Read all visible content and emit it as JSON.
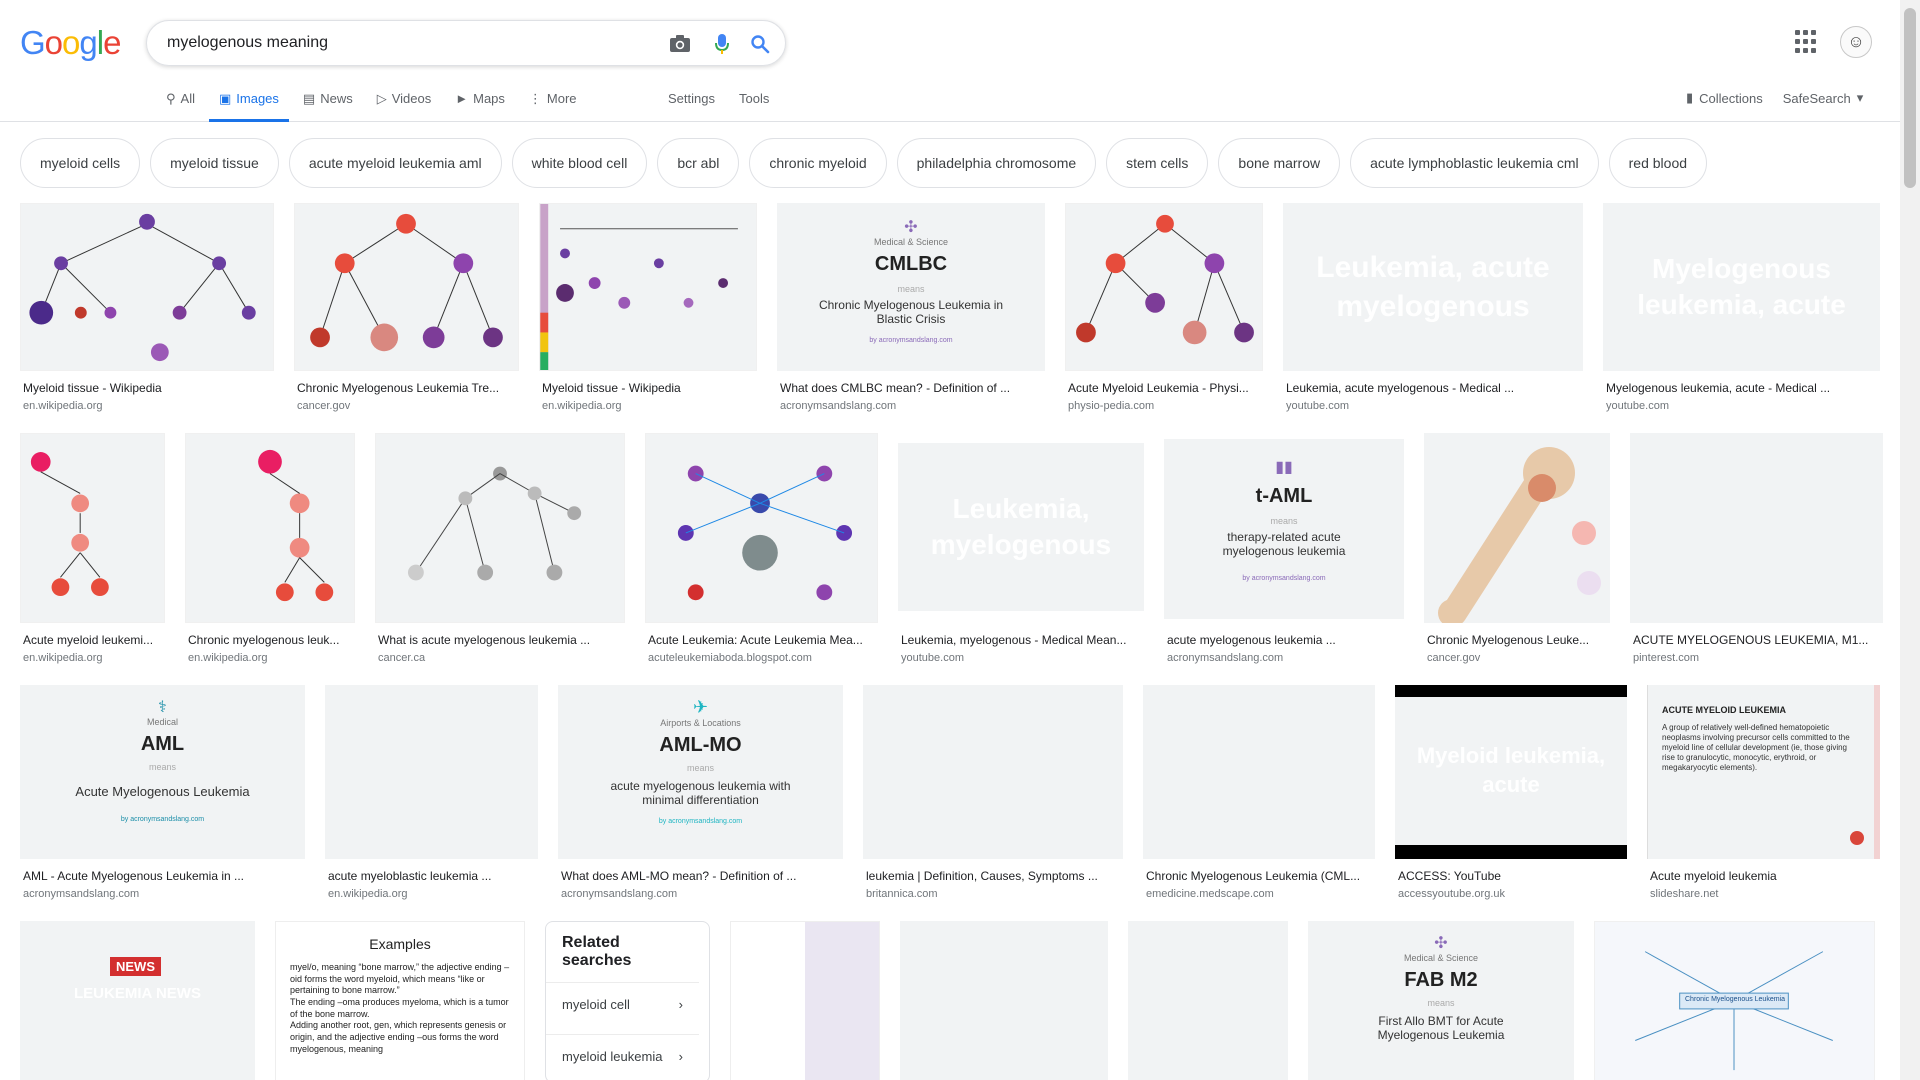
{
  "logo": {
    "g1": "G",
    "o1": "o",
    "o2": "o",
    "g2": "g",
    "l": "l",
    "e": "e"
  },
  "search": {
    "value": "myelogenous meaning"
  },
  "tabs": [
    {
      "label": "All",
      "icon": "search-icon"
    },
    {
      "label": "Images",
      "icon": "image-icon"
    },
    {
      "label": "News",
      "icon": "news-icon"
    },
    {
      "label": "Videos",
      "icon": "play-icon"
    },
    {
      "label": "Maps",
      "icon": "map-icon"
    },
    {
      "label": "More",
      "icon": "more-vert-icon"
    }
  ],
  "tools": {
    "settings": "Settings",
    "tools": "Tools"
  },
  "right_nav": {
    "collections": "Collections",
    "safesearch": "SafeSearch"
  },
  "chips": [
    "myeloid cells",
    "myeloid tissue",
    "acute myeloid leukemia aml",
    "white blood cell",
    "bcr abl",
    "chronic myeloid",
    "philadelphia chromosome",
    "stem cells",
    "bone marrow",
    "acute lymphoblastic leukemia cml",
    "red blood"
  ],
  "rows": [
    [
      {
        "title": "Myeloid tissue - Wikipedia",
        "src": "en.wikipedia.org"
      },
      {
        "title": "Chronic Myelogenous Leukemia Tre...",
        "src": "cancer.gov"
      },
      {
        "title": "Myeloid tissue - Wikipedia",
        "src": "en.wikipedia.org"
      },
      {
        "title": "What does CMLBC mean? - Definition of ...",
        "src": "acronymsandslang.com",
        "acr_top": "Medical & Science",
        "acr_big": "CMLBC",
        "acr_means": "means",
        "acr_full": "Chronic Myelogenous Leukemia in Blastic Crisis",
        "acr_brand": "by acronymsandslang.com"
      },
      {
        "title": "Acute Myeloid Leukemia - Physi...",
        "src": "physio-pedia.com"
      },
      {
        "title": "Leukemia, acute myelogenous - Medical ...",
        "src": "youtube.com",
        "overlay": "Leukemia, acute myelogenous"
      },
      {
        "title": "Myelogenous leukemia, acute - Medical ...",
        "src": "youtube.com",
        "overlay": "Myelogenous leukemia, acute"
      }
    ],
    [
      {
        "title": "Acute myeloid leukemi...",
        "src": "en.wikipedia.org"
      },
      {
        "title": "Chronic myelogenous leuk...",
        "src": "en.wikipedia.org"
      },
      {
        "title": "What is acute myelogenous leukemia ...",
        "src": "cancer.ca"
      },
      {
        "title": "Acute Leukemia: Acute Leukemia Mea...",
        "src": "acuteleukemiaboda.blogspot.com"
      },
      {
        "title": "Leukemia, myelogenous - Medical Mean...",
        "src": "youtube.com",
        "overlay": "Leukemia, myelogenous"
      },
      {
        "title": "acute myelogenous leukemia ...",
        "src": "acronymsandslang.com",
        "acr_big": "t-AML",
        "acr_means": "means",
        "acr_full": "therapy-related acute myelogenous leukemia",
        "acr_brand": "by acronymsandslang.com"
      },
      {
        "title": "Chronic Myelogenous Leuke...",
        "src": "cancer.gov"
      },
      {
        "title": "ACUTE MYELOGENOUS LEUKEMIA, M1...",
        "src": "pinterest.com"
      }
    ],
    [
      {
        "title": "AML - Acute Myelogenous Leukemia in ...",
        "src": "acronymsandslang.com",
        "acr_top": "Medical",
        "acr_big": "AML",
        "acr_means": "means",
        "acr_full": "Acute Myelogenous Leukemia",
        "acr_brand": "by acronymsandslang.com"
      },
      {
        "title": "acute myeloblastic leukemia ...",
        "src": "en.wikipedia.org"
      },
      {
        "title": "What does AML-MO mean? - Definition of ...",
        "src": "acronymsandslang.com",
        "acr_top": "Airports & Locations",
        "acr_big": "AML-MO",
        "acr_means": "means",
        "acr_full": "acute myelogenous leukemia with minimal differentiation",
        "acr_brand": "by acronymsandslang.com"
      },
      {
        "title": "leukemia | Definition, Causes, Symptoms ...",
        "src": "britannica.com"
      },
      {
        "title": "Chronic Myelogenous Leukemia (CML...",
        "src": "emedicine.medscape.com"
      },
      {
        "title": "ACCESS: YouTube",
        "src": "accessyoutube.org.uk",
        "overlay": "Myeloid leukemia, acute"
      },
      {
        "title": "Acute myeloid leukemia",
        "src": "slideshare.net",
        "slide_title": "Acute myeloid leukemia",
        "slide_text": "A group of relatively well-defined hematopoietic neoplasms involving precursor cells committed to the myeloid line of cellular development (ie, those giving rise to granulocytic, monocytic, erythroid, or megakaryocytic elements)."
      }
    ],
    [
      {
        "news_badge": "NEWS",
        "news_title": "LEUKEMIA NEWS"
      },
      {
        "ex_title": "Examples",
        "ex_items": [
          "myel/o, meaning “bone marrow,” the adjective ending –oid forms the word myeloid, which means “like or pertaining to bone marrow.”",
          "The ending –oma produces myeloma, which is a tumor of the bone marrow.",
          "Adding another root, gen, which represents genesis or origin, and the adjective ending –ous forms the word myelogenous, meaning"
        ]
      },
      {
        "related_title": "Related searches",
        "related_items": [
          "myeloid cell",
          "myeloid leukemia"
        ]
      },
      {},
      {},
      {},
      {
        "acr_top": "Medical & Science",
        "acr_big": "FAB M2",
        "acr_means": "means",
        "acr_full": "First Allo BMT for Acute Myelogenous Leukemia"
      },
      {
        "center_label": "Chronic Myelogenous Leukemia"
      }
    ]
  ]
}
